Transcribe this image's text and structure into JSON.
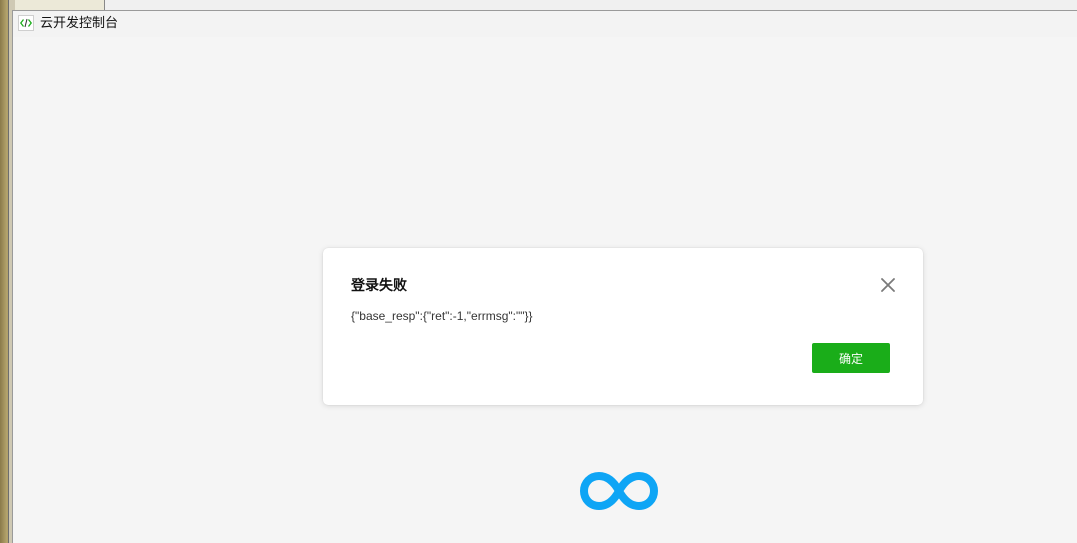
{
  "window": {
    "title": "云开发控制台"
  },
  "dialog": {
    "title": "登录失败",
    "message": "{\"base_resp\":{\"ret\":-1,\"errmsg\":\"\"}}",
    "confirm_label": "确定",
    "close_icon": "close-icon"
  },
  "colors": {
    "confirm_button": "#1aad19",
    "logo": "#0ea5f5",
    "background": "#f5f5f5"
  },
  "logo": {
    "icon": "cloudbase-infinity-logo"
  }
}
